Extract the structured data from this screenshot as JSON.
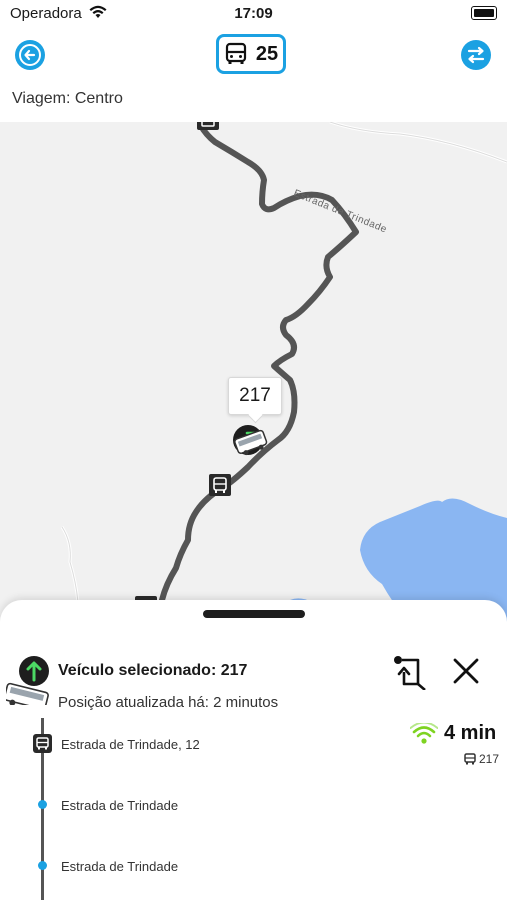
{
  "status_bar": {
    "carrier": "Operadora",
    "time": "17:09"
  },
  "header": {
    "route_number": "25",
    "trip_label": "Viagem: Centro",
    "accent_color": "#1ba1e2"
  },
  "map": {
    "road_label": "Estrada de Trindade",
    "vehicle_callout": "217",
    "water_color": "#8ab6f2",
    "route_line_color": "#555555"
  },
  "sheet": {
    "vehicle_title": "Veículo selecionado: 217",
    "updated_text": "Posição atualizada há: 2 minutos",
    "eta": "4 min",
    "eta_vehicle": "217",
    "live_signal_color": "#7ed321",
    "stops": [
      {
        "name": "Estrada de Trindade, 12",
        "type": "bus-stop"
      },
      {
        "name": "Estrada de Trindade",
        "type": "point"
      },
      {
        "name": "Estrada de Trindade",
        "type": "point"
      }
    ]
  }
}
